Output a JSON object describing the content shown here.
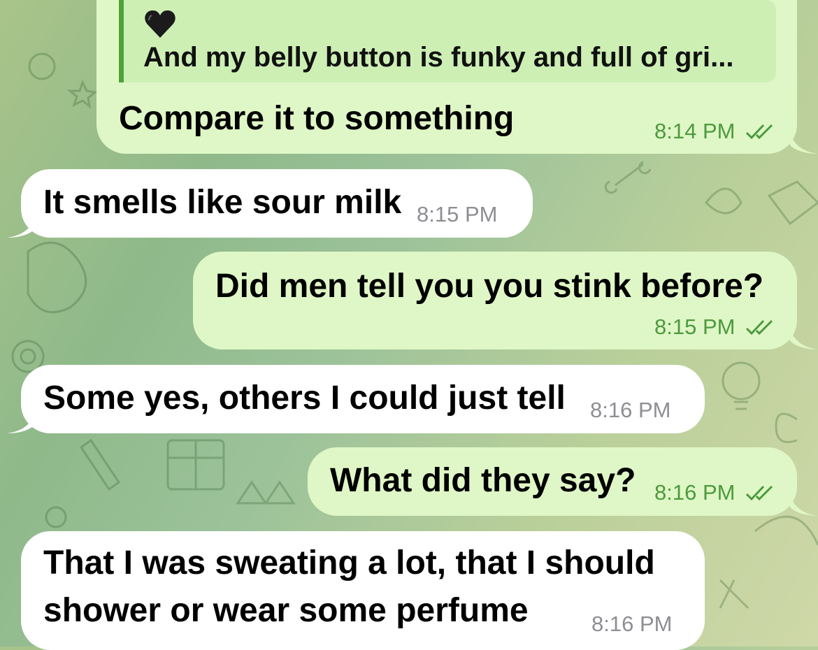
{
  "messages": [
    {
      "direction": "outgoing",
      "reply": {
        "icon": "black-heart-icon",
        "text": "And my belly button is funky and full of gri..."
      },
      "text": "Compare it to something",
      "time": "8:14 PM",
      "status": "read"
    },
    {
      "direction": "incoming",
      "text": "It smells like sour milk",
      "time": "8:15 PM"
    },
    {
      "direction": "outgoing",
      "text": "Did men tell you you stink before?",
      "time": "8:15 PM",
      "status": "read"
    },
    {
      "direction": "incoming",
      "text": "Some yes, others I could just tell",
      "time": "8:16 PM"
    },
    {
      "direction": "outgoing",
      "text": "What did they say?",
      "time": "8:16 PM",
      "status": "read"
    },
    {
      "direction": "incoming",
      "text_line1": "That I was sweating a lot, that I should",
      "text_line2": "shower or wear some perfume",
      "time": "8:16 PM"
    }
  ],
  "colors": {
    "outgoing_bubble": "#dff7c6",
    "incoming_bubble": "#ffffff",
    "reply_accent": "#4ea338",
    "outgoing_time": "#4c9a3e",
    "incoming_time": "#8e8e93"
  }
}
